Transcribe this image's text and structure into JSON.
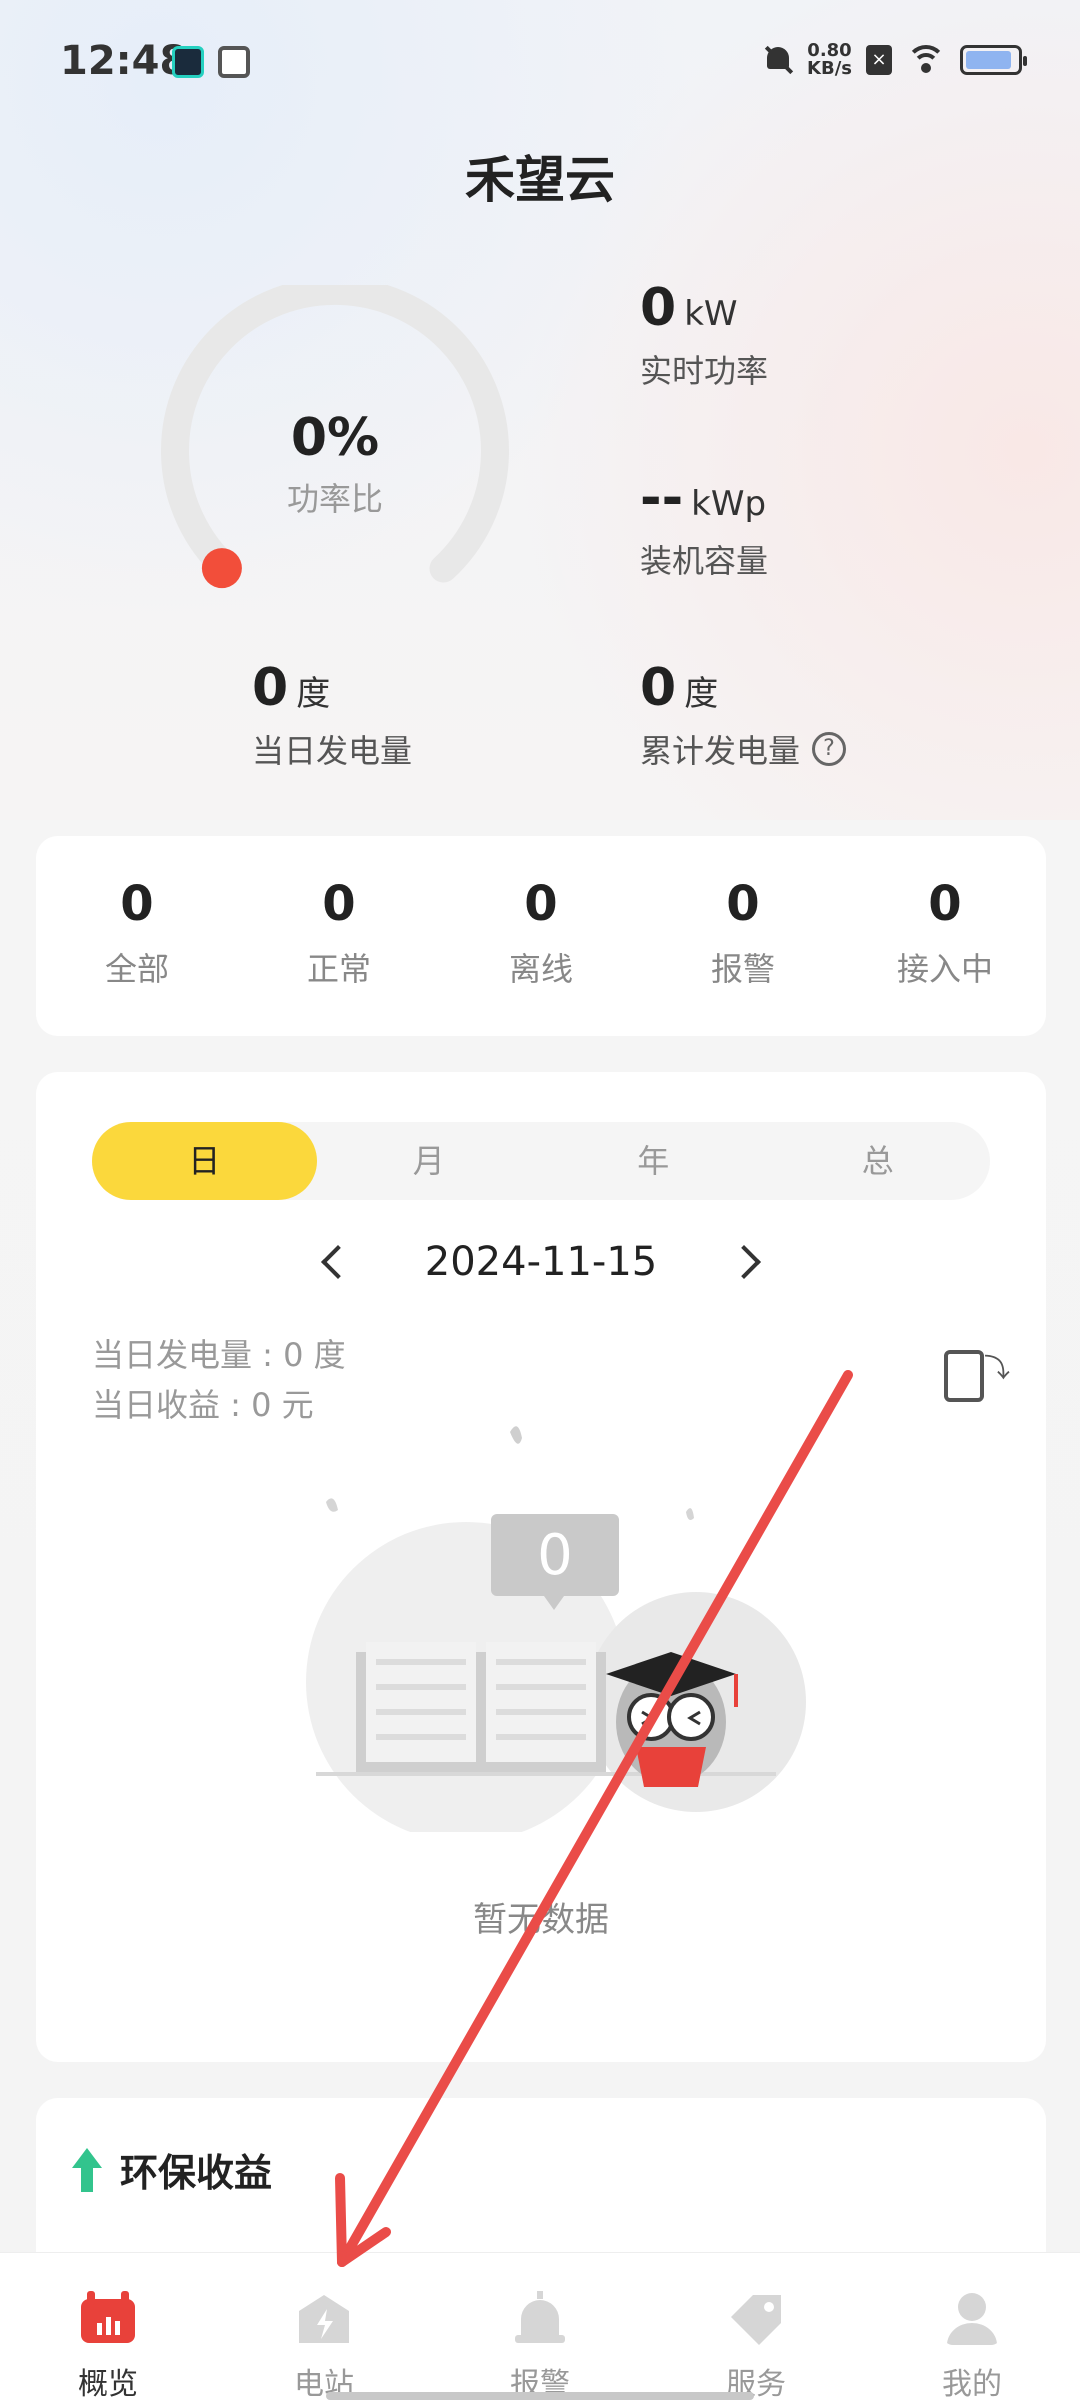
{
  "status_bar": {
    "time": "12:48",
    "net_speed_value": "0.80",
    "net_speed_unit": "KB/s",
    "battery_level": 0.9
  },
  "app": {
    "title": "禾望云"
  },
  "gauge": {
    "value": "0%",
    "label": "功率比",
    "fraction": 0
  },
  "metrics": {
    "realtime_power": {
      "value": "0",
      "unit": "kW",
      "label": "实时功率"
    },
    "installed_capacity": {
      "value": "--",
      "unit": "kWp",
      "label": "装机容量"
    },
    "daily_generation": {
      "value": "0",
      "unit": "度",
      "label": "当日发电量"
    },
    "total_generation": {
      "value": "0",
      "unit": "度",
      "label": "累计发电量"
    }
  },
  "station_counts": [
    {
      "value": "0",
      "label": "全部"
    },
    {
      "value": "0",
      "label": "正常"
    },
    {
      "value": "0",
      "label": "离线"
    },
    {
      "value": "0",
      "label": "报警"
    },
    {
      "value": "0",
      "label": "接入中"
    }
  ],
  "period_tabs": [
    {
      "label": "日",
      "active": true
    },
    {
      "label": "月",
      "active": false
    },
    {
      "label": "年",
      "active": false
    },
    {
      "label": "总",
      "active": false
    }
  ],
  "date": "2024-11-15",
  "summary": {
    "daily_generation": "当日发电量 : 0 度",
    "daily_income": "当日收益 : 0 元"
  },
  "empty_state": {
    "badge": "0",
    "text": "暂无数据"
  },
  "eco": {
    "title": "环保收益"
  },
  "bottom_nav": [
    {
      "label": "概览",
      "active": true,
      "icon": "overview-icon"
    },
    {
      "label": "电站",
      "active": false,
      "icon": "station-icon"
    },
    {
      "label": "报警",
      "active": false,
      "icon": "alarm-icon"
    },
    {
      "label": "服务",
      "active": false,
      "icon": "service-icon"
    },
    {
      "label": "我的",
      "active": false,
      "icon": "profile-icon"
    }
  ],
  "colors": {
    "accent_yellow": "#fbd83c",
    "gauge_dot": "#f24e3a",
    "brand_red": "#e8413a",
    "eco_green": "#32c48d",
    "annotation_arrow": "#ea4c48"
  }
}
